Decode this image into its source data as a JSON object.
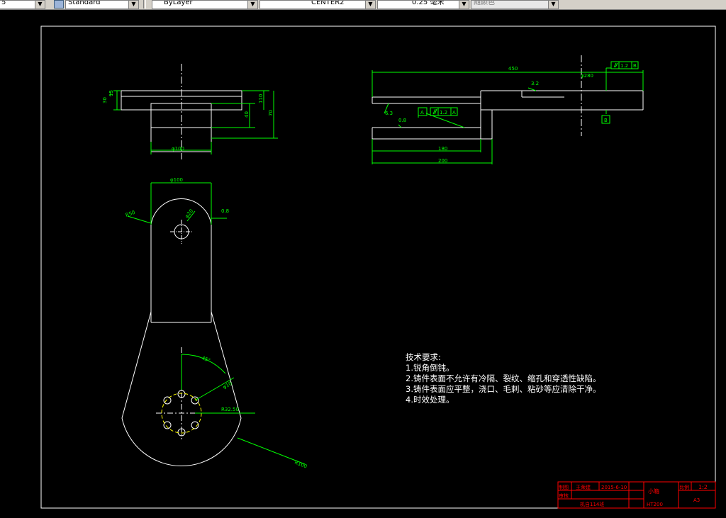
{
  "toolbar": {
    "dim_scale_value": "5",
    "text_style": "Standard",
    "layer_color": "ByLayer",
    "linetype": "CENTER2",
    "lineweight": "0.25 毫米",
    "plot_style": "随颜色"
  },
  "dimensions": {
    "overall_length": "450",
    "diameter_280": "φ280",
    "length_180": "180",
    "length_200": "200",
    "diameter_100_top": "φ100",
    "diameter_100_mid": "φ100",
    "thick_30": "30",
    "thick_15": "15",
    "h_40": "40",
    "h_110": "110",
    "h_70": "70",
    "r50": "R50",
    "d20": "φ20",
    "angle_45": "45°",
    "d10": "φ10",
    "r32_5": "R32.50",
    "r100": "R100"
  },
  "surface_finish": {
    "ra_3_2": "3.2",
    "ra_6_3": "6.3",
    "ra_0_8_a": "0.8",
    "ra_0_8_b": "0.8"
  },
  "gdt": {
    "datum_a": "A",
    "datum_b": "B",
    "parallel_tol": "1.2",
    "parallel_ref_b": "B",
    "parallel_ref_a": "A"
  },
  "notes": {
    "title": "技术要求:",
    "items": [
      "1.锐角倒钝。",
      "2.铸件表面不允许有冷隔、裂纹、缩孔和穿透性缺陷。",
      "3.铸件表面应平整，浇口、毛刺、粘砂等应清除干净。",
      "4.时效处理。"
    ]
  },
  "title_block": {
    "drawn_label": "制图",
    "drawn_name": "王荣建",
    "date": "2015-6-10",
    "part_name": "小箱",
    "scale_label": "比例",
    "scale": "1:2",
    "checked_label": "审核",
    "class": "机自114班",
    "material": "HT200",
    "sheet": "A3"
  },
  "colors": {
    "background": "#000000",
    "line": "#ffffff",
    "dimension": "#00ff00",
    "centerline": "#ffffff",
    "title_block": "#ff0000",
    "hidden": "#ffff00"
  }
}
